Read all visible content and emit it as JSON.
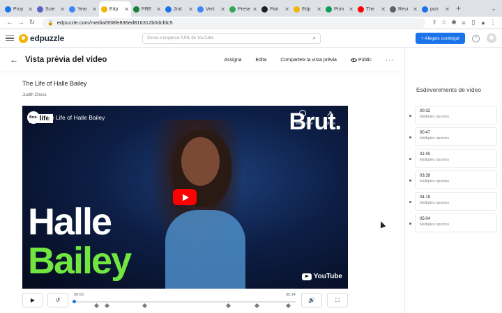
{
  "browser": {
    "tabs": [
      {
        "label": "Proy",
        "color": "#1a73e8"
      },
      {
        "label": "Scie",
        "color": "#5b5fc7"
      },
      {
        "label": "Year",
        "color": "#4285f4"
      },
      {
        "label": "Edp",
        "color": "#f5b400",
        "active": true
      },
      {
        "label": "PRE",
        "color": "#188038"
      },
      {
        "label": "2nd",
        "color": "#1a73e8"
      },
      {
        "label": "Vert",
        "color": "#4285f4"
      },
      {
        "label": "Prese",
        "color": "#34a853"
      },
      {
        "label": "Pan",
        "color": "#202124"
      },
      {
        "label": "Edp",
        "color": "#f5b400"
      },
      {
        "label": "Prim",
        "color": "#0f9d58"
      },
      {
        "label": "The",
        "color": "#ff0000"
      },
      {
        "label": "Revi",
        "color": "#5f6368"
      },
      {
        "label": "pun",
        "color": "#1a73e8"
      }
    ],
    "url": "edpuzzle.com/media/658fe836ed816312b0dcfdc5"
  },
  "app": {
    "logo": "edpuzzle",
    "search_placeholder": "Cerca o enganxa l'URL de YouTube",
    "add_button": "+ Afegeix contingut",
    "help": "?"
  },
  "page": {
    "title": "Vista prèvia del vídeo",
    "actions": [
      "Assigna",
      "Edita",
      "Comparteix la vista prèvia",
      "Públic"
    ],
    "video_title": "The Life of Halle Bailey",
    "author": "Judith Chess"
  },
  "player": {
    "overlay_title": "The Life of Halle Bailey",
    "channel": "Brut.",
    "brand_logo": "Brut.",
    "badge": "A life",
    "text_line1": "Halle",
    "text_line2": "Bailey",
    "watch_later": "Watch later",
    "share": "Share",
    "youtube": "YouTube",
    "time_start": "00:00",
    "time_end": "05:14",
    "progress": 0,
    "marker_seconds": [
      32,
      47,
      100,
      219,
      259,
      304
    ],
    "duration_seconds": 314
  },
  "sidebar": {
    "heading": "Esdeveniments de vídeo",
    "events": [
      {
        "time": "00:32",
        "type": "Múltiples opcions"
      },
      {
        "time": "00:47",
        "type": "Múltiples opcions"
      },
      {
        "time": "01:40",
        "type": "Múltiples opcions"
      },
      {
        "time": "03:39",
        "type": "Múltiples opcions"
      },
      {
        "time": "04:19",
        "type": "Múltiples opcions"
      },
      {
        "time": "05:04",
        "type": "Múltiples opcions"
      }
    ]
  }
}
